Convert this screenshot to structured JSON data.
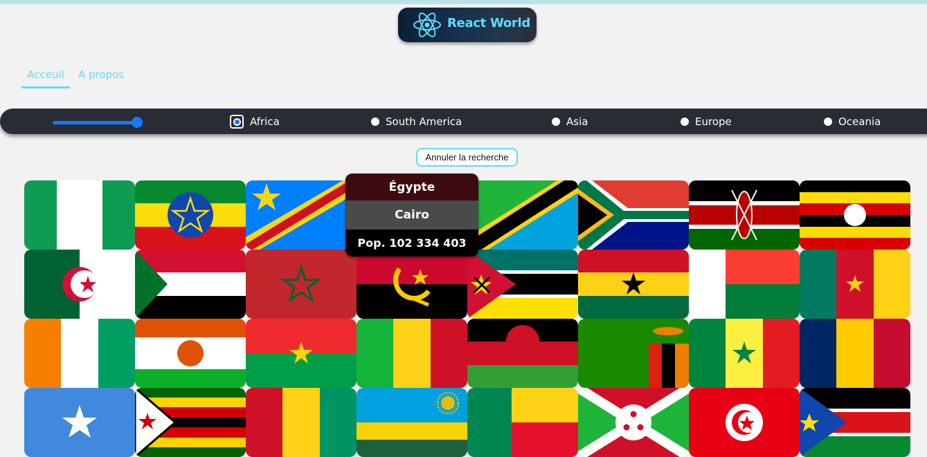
{
  "header": {
    "logo_text": "React World"
  },
  "nav": {
    "links": [
      {
        "label": "Acceuil"
      },
      {
        "label": "A propos"
      }
    ]
  },
  "filter": {
    "range_level": 1.0,
    "regions": [
      {
        "label": "Africa",
        "checked": true
      },
      {
        "label": "South America",
        "checked": false
      },
      {
        "label": "Asia",
        "checked": false
      },
      {
        "label": "Europe",
        "checked": false
      },
      {
        "label": "Oceania",
        "checked": false
      }
    ]
  },
  "cancel_button": {
    "label": "Annuler la recherche"
  },
  "tooltip": {
    "name": "Égypte",
    "capital": "Cairo",
    "population": "Pop. 102 334 403"
  },
  "flags": [
    "nigeria-flag",
    "ethiopia-flag",
    "dr-congo-flag",
    "egypt-flag",
    "tanzania-flag",
    "south-africa-flag",
    "kenya-flag",
    "uganda-flag",
    "algeria-flag",
    "sudan-flag",
    "morocco-flag",
    "angola-flag",
    "mozambique-flag",
    "ghana-flag",
    "madagascar-flag",
    "cameroon-flag",
    "ivory-coast-flag",
    "niger-flag",
    "burkina-faso-flag",
    "mali-flag",
    "malawi-flag",
    "zambia-flag",
    "senegal-flag",
    "chad-flag",
    "somalia-flag",
    "zimbabwe-flag",
    "guinea-flag",
    "rwanda-flag",
    "benin-flag",
    "burundi-flag",
    "tunisia-flag",
    "south-sudan-flag"
  ],
  "colors": {
    "accent": "#61dafb",
    "bar": "#282c34",
    "radio_active": "#1677ff"
  }
}
